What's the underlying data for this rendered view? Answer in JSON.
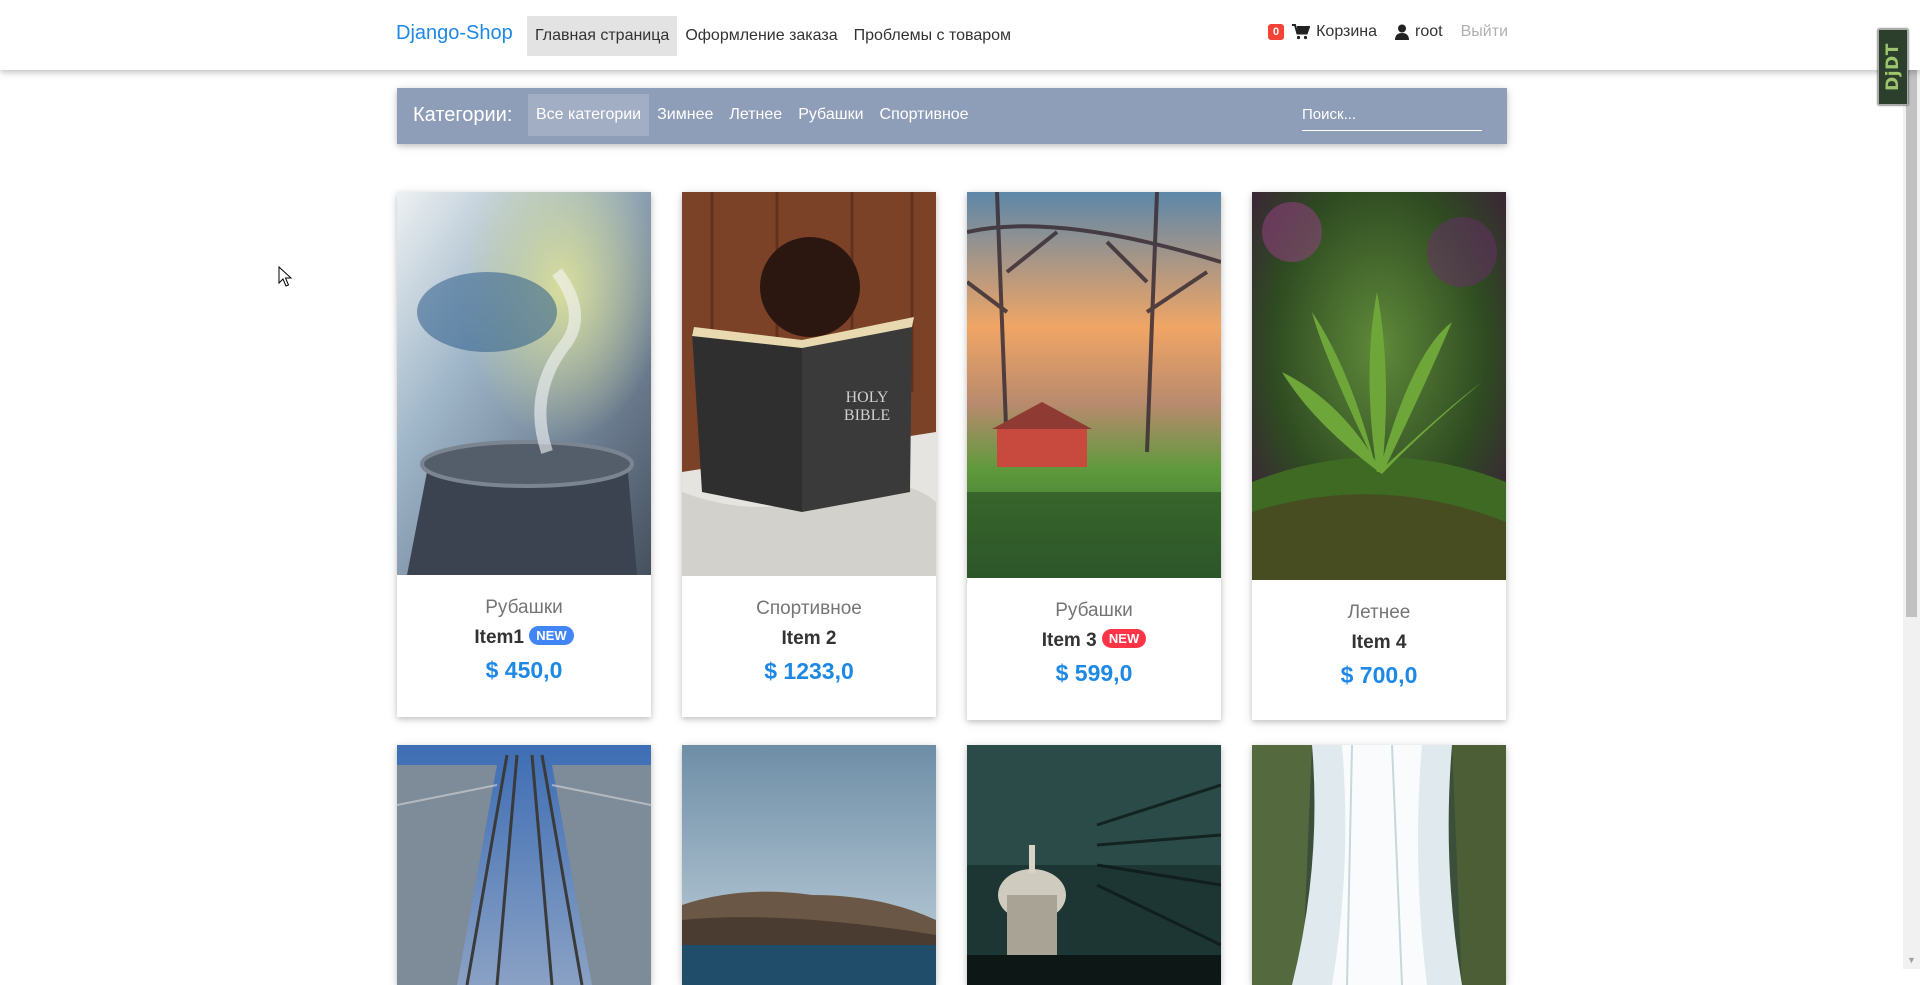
{
  "brand": "Django-Shop",
  "nav": {
    "links": [
      "Главная страница",
      "Оформление заказа",
      "Проблемы с товаром"
    ],
    "cart_count": "0",
    "cart_label": "Корзина",
    "user_label": "root",
    "logout_label": "Выйти"
  },
  "debug_toolbar": "DjDT",
  "categories": {
    "title": "Категории:",
    "items": [
      "Все категории",
      "Зимнее",
      "Летнее",
      "Рубашки",
      "Спортивное"
    ],
    "search_placeholder": "Поиск..."
  },
  "products": [
    {
      "category": "Рубашки",
      "name": "Item1",
      "badge": "NEW",
      "badge_color": "#4285f4",
      "price": "$ 450,0",
      "image": "steaming-mug"
    },
    {
      "category": "Спортивное",
      "name": "Item 2",
      "badge": "",
      "price": "$ 1233,0",
      "image": "child-reading-bible"
    },
    {
      "category": "Рубашки",
      "name": "Item 3",
      "badge": "NEW",
      "badge_color": "#ff3547",
      "price": "$ 599,0",
      "image": "autumn-trees-barn"
    },
    {
      "category": "Летнее",
      "name": "Item 4",
      "badge": "",
      "price": "$ 700,0",
      "image": "green-plant-moss"
    },
    {
      "image": "railway-tracks"
    },
    {
      "image": "rocky-coast-sea"
    },
    {
      "image": "city-dome-night"
    },
    {
      "image": "waterfall"
    }
  ],
  "colors": {
    "accent": "#1e88e5",
    "category_bar": "#8e9db8",
    "badge_cart": "#f44336"
  }
}
